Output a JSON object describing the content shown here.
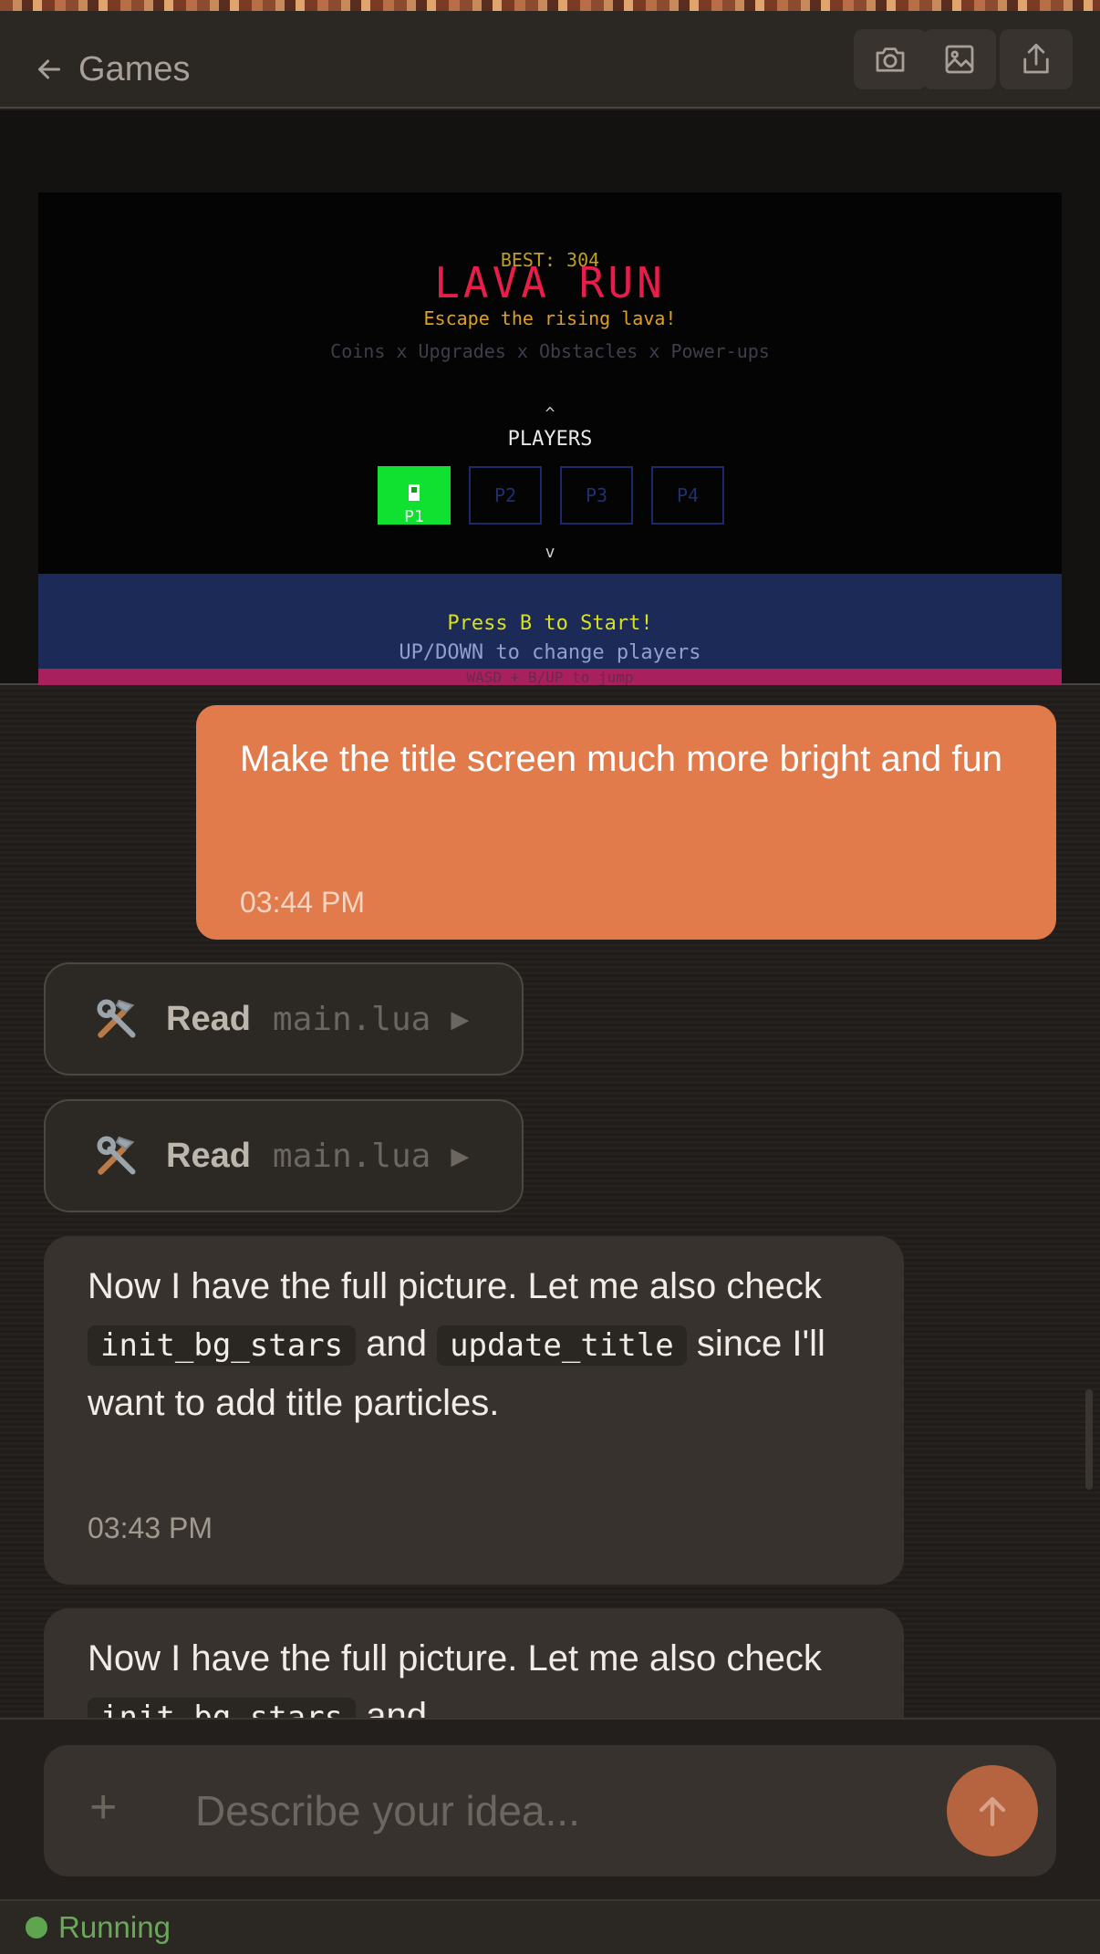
{
  "header": {
    "back_label": "Games",
    "actions": [
      "camera-icon",
      "image-icon",
      "share-icon"
    ]
  },
  "game": {
    "best": "BEST: 304",
    "title": "LAVA  RUN",
    "subtitle": "Escape the rising lava!",
    "features": "Coins x Upgrades x Obstacles x Power-ups",
    "caret_up": "^",
    "players_label": "PLAYERS",
    "slots": [
      "P1",
      "P2",
      "P3",
      "P4"
    ],
    "caret_down": "v",
    "press_start": "Press B to Start!",
    "updown": "UP/DOWN to change players",
    "wasd": "WASD + B/UP to jump"
  },
  "messages": {
    "user": {
      "text": "Make the title screen much more bright and fun",
      "time": "03:44 PM"
    },
    "tool_calls": [
      {
        "action": "Read",
        "file": "main.lua"
      },
      {
        "action": "Read",
        "file": "main.lua"
      }
    ],
    "assistant": [
      {
        "pre": "Now I have the full picture. Let me also check ",
        "code1": "init_bg_stars",
        "mid": " and ",
        "code2": "update_title",
        "post": " since I'll want to add title particles.",
        "time": "03:43 PM"
      },
      {
        "pre": "Now I have the full picture. Let me also check ",
        "code1": "init_bg_stars",
        "mid": " and"
      }
    ]
  },
  "composer": {
    "placeholder": "Describe your idea...",
    "value": ""
  },
  "status": {
    "label": "Running",
    "color": "#5fa44f"
  },
  "colors": {
    "accent": "#e17b4c",
    "send_button": "#b5643f",
    "assistant_bubble": "#37322d"
  }
}
